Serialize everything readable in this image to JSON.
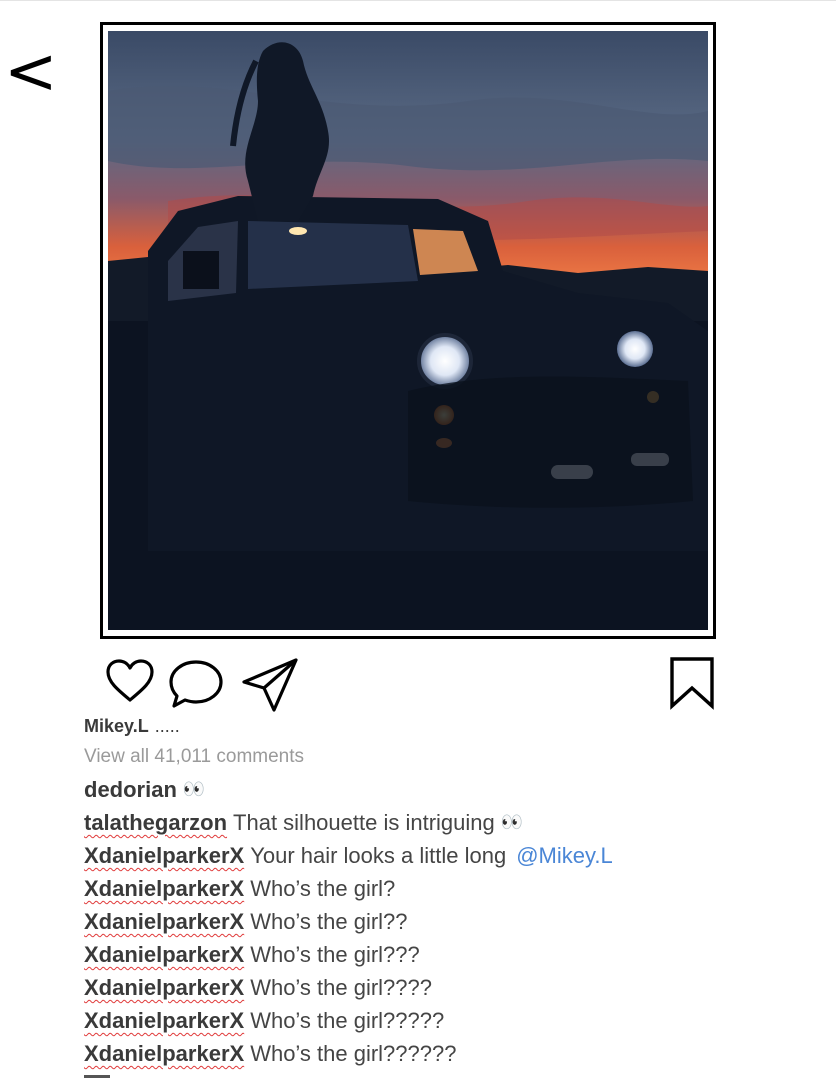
{
  "nav": {
    "back_label": "<"
  },
  "post": {
    "author": "Mikey.L",
    "caption": ".....",
    "view_all_comments": "View all 41,011 comments"
  },
  "actions": {
    "like_icon": "heart-icon",
    "comment_icon": "comment-bubble-icon",
    "share_icon": "paper-plane-icon",
    "save_icon": "bookmark-icon"
  },
  "comments": [
    {
      "user": "dedorian",
      "text": "",
      "emoji": "👀",
      "mention": ""
    },
    {
      "user": "talathegarzon",
      "text": "That silhouette is intriguing",
      "emoji": "👀",
      "mention": ""
    },
    {
      "user": "XdanielparkerX",
      "text": "Your hair looks a little long",
      "emoji": "",
      "mention": "@Mikey.L"
    },
    {
      "user": "XdanielparkerX",
      "text": "Who’s the girl?",
      "emoji": "",
      "mention": ""
    },
    {
      "user": "XdanielparkerX",
      "text": "Who’s the girl??",
      "emoji": "",
      "mention": ""
    },
    {
      "user": "XdanielparkerX",
      "text": "Who’s the girl???",
      "emoji": "",
      "mention": ""
    },
    {
      "user": "XdanielparkerX",
      "text": "Who’s the girl????",
      "emoji": "",
      "mention": ""
    },
    {
      "user": "XdanielparkerX",
      "text": "Who’s the girl?????",
      "emoji": "",
      "mention": ""
    },
    {
      "user": "XdanielparkerX",
      "text": "Who’s the girl??????",
      "emoji": "",
      "mention": ""
    }
  ],
  "colors": {
    "mention": "#4a86d6",
    "muted_text": "#9a9a9a",
    "spellcheck_underline": "#e03a3a",
    "sky_orange": "#e8643a"
  }
}
